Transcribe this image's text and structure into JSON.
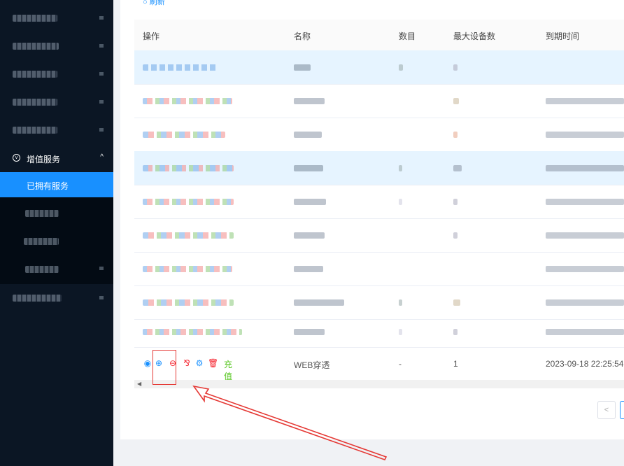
{
  "sidebar": {
    "group_label": "增值服务",
    "group_icon": "circle-v-icon",
    "active_item": "已拥有服务"
  },
  "toolbar": {
    "refresh_label": "刷新"
  },
  "table": {
    "columns": [
      "操作",
      "名称",
      "数目",
      "最大设备数",
      "到期时间"
    ],
    "last_row": {
      "recharge_label": "充值",
      "name": "WEB穿透",
      "count": "-",
      "max_devices": "1",
      "expiry": "2023-09-18 22:25:54"
    }
  },
  "pager": {
    "prev_label": "<"
  },
  "colors": {
    "accent": "#1890ff",
    "sidebar_bg": "#0b1624",
    "danger": "#f5222d",
    "success": "#52c41a",
    "highlight_row": "#e6f4ff"
  }
}
